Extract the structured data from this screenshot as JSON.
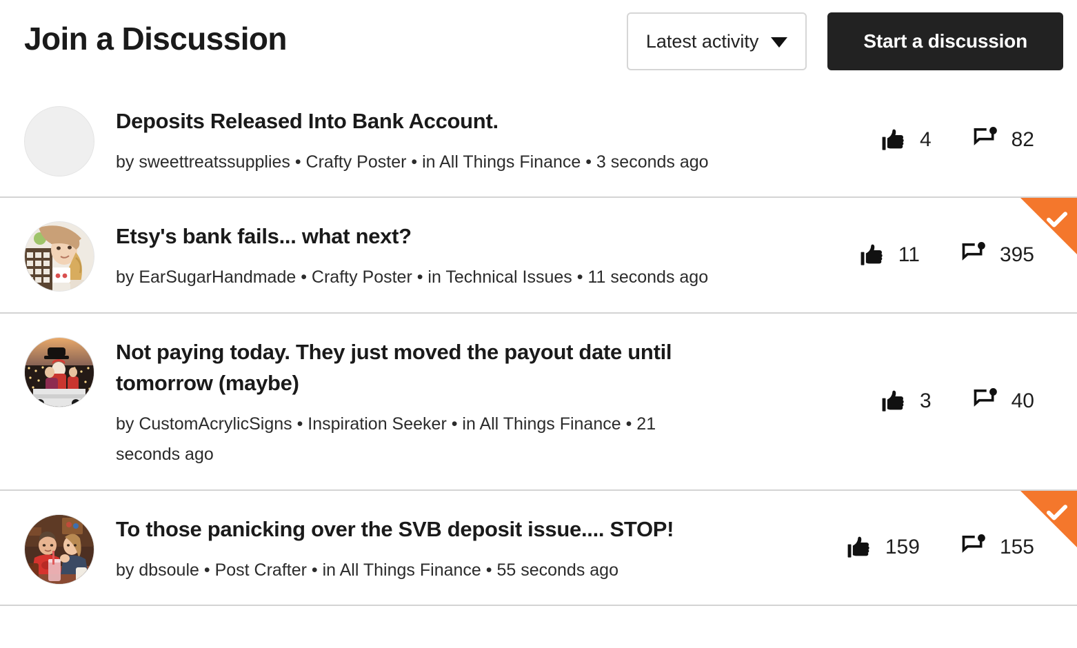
{
  "header": {
    "title": "Join a Discussion",
    "sort": {
      "selected": "Latest activity",
      "icon": "chevron-down-icon",
      "options": [
        "Latest activity"
      ]
    },
    "start_button": "Start a discussion"
  },
  "colors": {
    "accent_orange": "#f4772c",
    "button_dark": "#222222",
    "divider": "#d3d3d3",
    "text": "#1a1a1a"
  },
  "icons": {
    "like": "thumbs-up-icon",
    "comment": "comment-bubble-icon",
    "verified": "check-icon"
  },
  "discussions": [
    {
      "title": "Deposits Released Into Bank Account.",
      "meta": "by sweettreatssupplies • Crafty Poster • in All Things Finance • 3 seconds ago",
      "author": "sweettreatssupplies",
      "badge": "Crafty Poster",
      "forum": "All Things Finance",
      "time": "3 seconds ago",
      "likes": "4",
      "comments": "82",
      "avatar": "placeholder",
      "flagged": false
    },
    {
      "title": "Etsy's bank fails... what next?",
      "meta": "by EarSugarHandmade • Crafty Poster • in Technical Issues • 11 seconds ago",
      "author": "EarSugarHandmade",
      "badge": "Crafty Poster",
      "forum": "Technical Issues",
      "time": "11 seconds ago",
      "likes": "11",
      "comments": "395",
      "avatar": "woman-in-hat-photo",
      "flagged": true
    },
    {
      "title": "Not paying today. They just moved the payout date until tomorrow (maybe)",
      "meta": "by CustomAcrylicSigns • Inspiration Seeker • in All Things Finance • 21 seconds ago",
      "author": "CustomAcrylicSigns",
      "badge": "Inspiration Seeker",
      "forum": "All Things Finance",
      "time": "21 seconds ago",
      "likes": "3",
      "comments": "40",
      "avatar": "santa-christmas-photo",
      "flagged": false
    },
    {
      "title": "To those panicking over the SVB deposit issue.... STOP!",
      "meta": "by dbsoule • Post Crafter • in All Things Finance • 55 seconds ago",
      "author": "dbsoule",
      "badge": "Post Crafter",
      "forum": "All Things Finance",
      "time": "55 seconds ago",
      "likes": "159",
      "comments": "155",
      "avatar": "couple-restaurant-photo",
      "flagged": true
    }
  ]
}
